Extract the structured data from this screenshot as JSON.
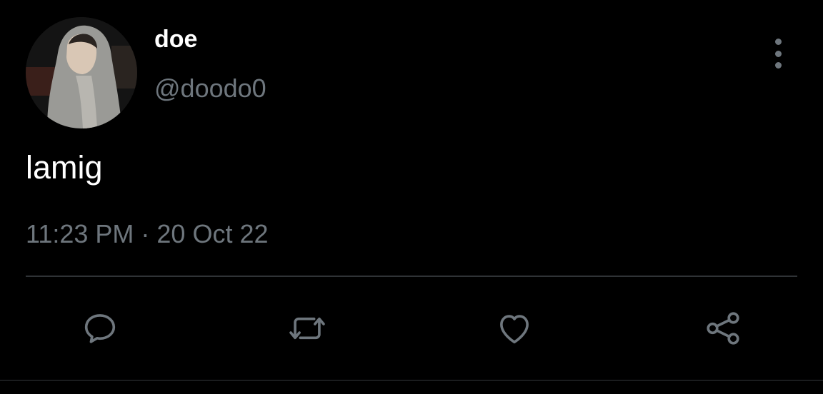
{
  "author": {
    "display_name": "doe",
    "handle": "@doodo0"
  },
  "tweet": {
    "text": "lamig",
    "timestamp": "11:23 PM · 20 Oct 22"
  },
  "actions": [
    {
      "name": "reply",
      "icon": "reply-icon"
    },
    {
      "name": "retweet",
      "icon": "retweet-icon"
    },
    {
      "name": "like",
      "icon": "heart-icon"
    },
    {
      "name": "share",
      "icon": "share-icon"
    }
  ],
  "colors": {
    "background": "#000000",
    "primary_text": "#ffffff",
    "secondary_text": "#6e767d",
    "divider": "#2f3336"
  }
}
